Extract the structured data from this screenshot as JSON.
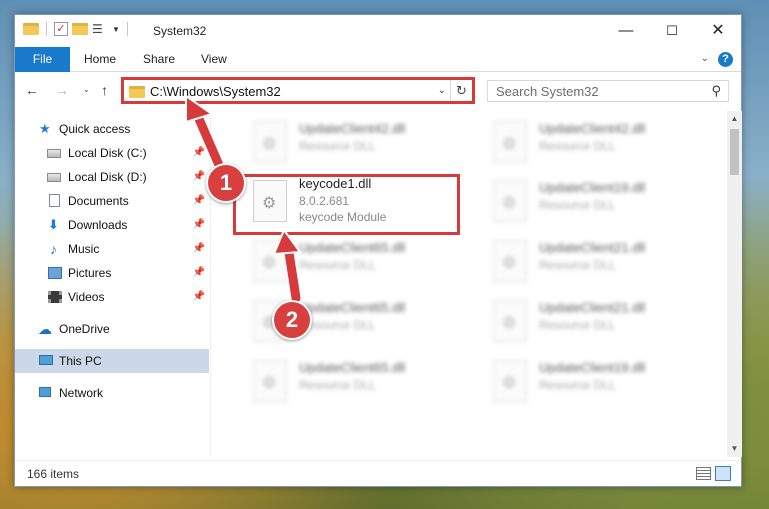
{
  "window": {
    "title": "System32",
    "controls": {
      "minimize": "—",
      "maximize": "☐",
      "close": "✕"
    }
  },
  "ribbon": {
    "tabs": [
      {
        "label": "File"
      },
      {
        "label": "Home"
      },
      {
        "label": "Share"
      },
      {
        "label": "View"
      }
    ],
    "help": "?"
  },
  "navigation": {
    "back": "←",
    "forward": "→",
    "recent": "⌄",
    "up": "↑",
    "address": "C:\\Windows\\System32",
    "refresh": "↻",
    "search_placeholder": "Search System32"
  },
  "sidebar": {
    "items": [
      {
        "label": "Quick access",
        "icon": "star-icon"
      },
      {
        "label": "Local Disk (C:)",
        "icon": "disk-icon",
        "pinned": true
      },
      {
        "label": "Local Disk (D:)",
        "icon": "disk-icon",
        "pinned": true
      },
      {
        "label": "Documents",
        "icon": "documents-icon",
        "pinned": true
      },
      {
        "label": "Downloads",
        "icon": "download-icon",
        "pinned": true
      },
      {
        "label": "Music",
        "icon": "music-icon",
        "pinned": true
      },
      {
        "label": "Pictures",
        "icon": "pictures-icon",
        "pinned": true
      },
      {
        "label": "Videos",
        "icon": "videos-icon",
        "pinned": true
      },
      {
        "label": "OneDrive",
        "icon": "cloud-icon"
      },
      {
        "label": "This PC",
        "icon": "pc-icon",
        "selected": true
      },
      {
        "label": "Network",
        "icon": "network-icon"
      }
    ]
  },
  "files": {
    "col1": [
      {
        "name": "UpdateClient42.dll",
        "desc": "Resource DLL"
      },
      {
        "name": "keycode1.dll",
        "version": "8.0.2.681",
        "desc": "keycode Module"
      },
      {
        "name": "UpdateClient65.dll",
        "desc": "Resource DLL"
      },
      {
        "name": "UpdateClient65.dll",
        "desc": "Resource DLL"
      },
      {
        "name": "UpdateClient65.dll",
        "desc": "Resource DLL"
      }
    ],
    "col2": [
      {
        "name": "UpdateClient42.dll",
        "desc": "Resource DLL"
      },
      {
        "name": "UpdateClient19.dll",
        "desc": "Resource DLL"
      },
      {
        "name": "UpdateClient21.dll",
        "desc": "Resource DLL"
      },
      {
        "name": "UpdateClient21.dll",
        "desc": "Resource DLL"
      },
      {
        "name": "UpdateClient19.dll",
        "desc": "Resource DLL"
      }
    ]
  },
  "status": {
    "item_count": "166 items"
  },
  "annotations": {
    "step1": "1",
    "step2": "2",
    "color": "#d63a3a"
  }
}
